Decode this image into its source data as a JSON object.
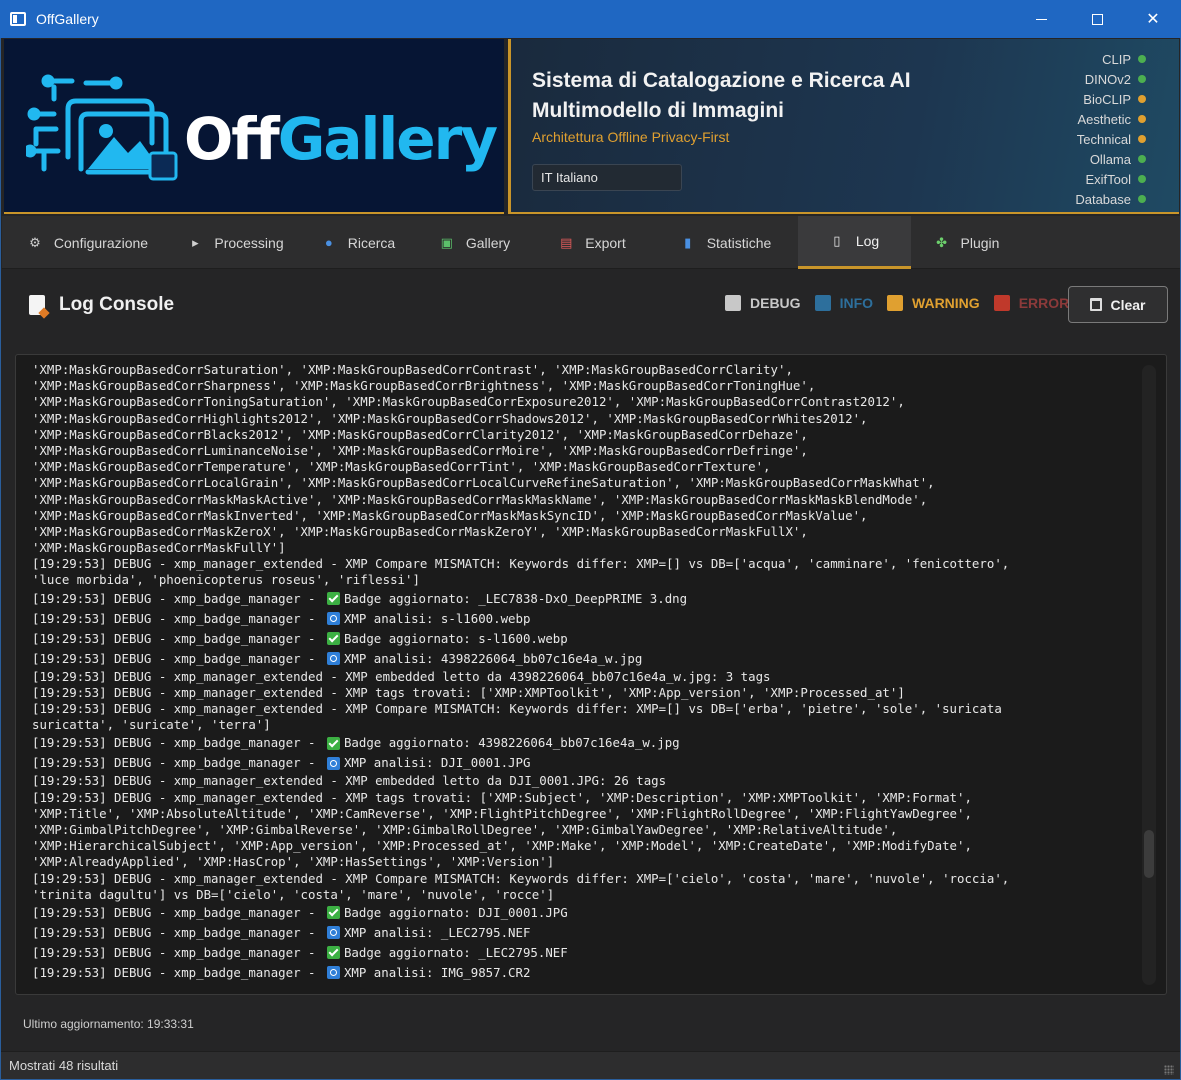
{
  "window": {
    "title": "OffGallery"
  },
  "header": {
    "logo_text_white": "Off",
    "logo_text_blue": "Gallery",
    "title": "Sistema di Catalogazione e Ricerca AI Multimodello di Immagini",
    "subtitle": "Architettura Offline Privacy-First",
    "language_select": "IT Italiano",
    "status": [
      {
        "name": "CLIP",
        "color": "#4caf50"
      },
      {
        "name": "DINOv2",
        "color": "#4caf50"
      },
      {
        "name": "BioCLIP",
        "color": "#e0a030"
      },
      {
        "name": "Aesthetic",
        "color": "#e0a030"
      },
      {
        "name": "Technical",
        "color": "#e0a030"
      },
      {
        "name": "Ollama",
        "color": "#4caf50"
      },
      {
        "name": "ExifTool",
        "color": "#4caf50"
      },
      {
        "name": "Database",
        "color": "#4caf50"
      }
    ]
  },
  "tabs": [
    {
      "label": "Configurazione",
      "icon": "gear-icon",
      "active": false
    },
    {
      "label": "Processing",
      "icon": "play-icon",
      "active": false
    },
    {
      "label": "Ricerca",
      "icon": "search-icon",
      "active": false
    },
    {
      "label": "Gallery",
      "icon": "image-icon",
      "active": false
    },
    {
      "label": "Export",
      "icon": "export-icon",
      "active": false
    },
    {
      "label": "Statistiche",
      "icon": "chart-icon",
      "active": false
    },
    {
      "label": "Log",
      "icon": "document-icon",
      "active": true
    },
    {
      "label": "Plugin",
      "icon": "puzzle-icon",
      "active": false
    }
  ],
  "console": {
    "title": "Log Console",
    "filters": [
      {
        "label": "DEBUG",
        "color": "#c8c8c8",
        "text_color": "#c8c8c8"
      },
      {
        "label": "INFO",
        "color": "#2d6f9c",
        "text_color": "#2d6f9c"
      },
      {
        "label": "WARNING",
        "color": "#e0a030",
        "text_color": "#e0a030"
      },
      {
        "label": "ERROR",
        "color": "#c0392b",
        "text_color": "#8c3a3a"
      }
    ],
    "clear_label": "Clear",
    "lines": [
      {
        "text": "'XMP:MaskGroupBasedCorrSaturation', 'XMP:MaskGroupBasedCorrContrast', 'XMP:MaskGroupBasedCorrClarity',",
        "badge": ""
      },
      {
        "text": "'XMP:MaskGroupBasedCorrSharpness', 'XMP:MaskGroupBasedCorrBrightness', 'XMP:MaskGroupBasedCorrToningHue',",
        "badge": ""
      },
      {
        "text": "'XMP:MaskGroupBasedCorrToningSaturation', 'XMP:MaskGroupBasedCorrExposure2012', 'XMP:MaskGroupBasedCorrContrast2012',",
        "badge": ""
      },
      {
        "text": "'XMP:MaskGroupBasedCorrHighlights2012', 'XMP:MaskGroupBasedCorrShadows2012', 'XMP:MaskGroupBasedCorrWhites2012',",
        "badge": ""
      },
      {
        "text": "'XMP:MaskGroupBasedCorrBlacks2012', 'XMP:MaskGroupBasedCorrClarity2012', 'XMP:MaskGroupBasedCorrDehaze',",
        "badge": ""
      },
      {
        "text": "'XMP:MaskGroupBasedCorrLuminanceNoise', 'XMP:MaskGroupBasedCorrMoire', 'XMP:MaskGroupBasedCorrDefringe',",
        "badge": ""
      },
      {
        "text": "'XMP:MaskGroupBasedCorrTemperature', 'XMP:MaskGroupBasedCorrTint', 'XMP:MaskGroupBasedCorrTexture',",
        "badge": ""
      },
      {
        "text": "'XMP:MaskGroupBasedCorrLocalGrain', 'XMP:MaskGroupBasedCorrLocalCurveRefineSaturation', 'XMP:MaskGroupBasedCorrMaskWhat',",
        "badge": ""
      },
      {
        "text": "'XMP:MaskGroupBasedCorrMaskMaskActive', 'XMP:MaskGroupBasedCorrMaskMaskName', 'XMP:MaskGroupBasedCorrMaskMaskBlendMode',",
        "badge": ""
      },
      {
        "text": "'XMP:MaskGroupBasedCorrMaskInverted', 'XMP:MaskGroupBasedCorrMaskMaskSyncID', 'XMP:MaskGroupBasedCorrMaskValue',",
        "badge": ""
      },
      {
        "text": "'XMP:MaskGroupBasedCorrMaskZeroX', 'XMP:MaskGroupBasedCorrMaskZeroY', 'XMP:MaskGroupBasedCorrMaskFullX',",
        "badge": ""
      },
      {
        "text": "'XMP:MaskGroupBasedCorrMaskFullY']",
        "badge": ""
      },
      {
        "text": "[19:29:53] DEBUG - xmp_manager_extended - XMP Compare MISMATCH: Keywords differ: XMP=[] vs DB=['acqua', 'camminare', 'fenicottero',",
        "badge": ""
      },
      {
        "text": "'luce morbida', 'phoenicopterus roseus', 'riflessi']",
        "badge": ""
      },
      {
        "prefix": "[19:29:53] DEBUG - xmp_badge_manager - ",
        "text": "Badge aggiornato: _LEC7838-DxO_DeepPRIME 3.dng",
        "badge": "ok"
      },
      {
        "prefix": "[19:29:53] DEBUG - xmp_badge_manager - ",
        "text": "XMP analisi: s-l1600.webp",
        "badge": "sync"
      },
      {
        "prefix": "[19:29:53] DEBUG - xmp_badge_manager - ",
        "text": "Badge aggiornato: s-l1600.webp",
        "badge": "ok"
      },
      {
        "prefix": "[19:29:53] DEBUG - xmp_badge_manager - ",
        "text": "XMP analisi: 4398226064_bb07c16e4a_w.jpg",
        "badge": "sync"
      },
      {
        "text": "[19:29:53] DEBUG - xmp_manager_extended - XMP embedded letto da 4398226064_bb07c16e4a_w.jpg: 3 tags",
        "badge": ""
      },
      {
        "text": "[19:29:53] DEBUG - xmp_manager_extended - XMP tags trovati: ['XMP:XMPToolkit', 'XMP:App_version', 'XMP:Processed_at']",
        "badge": ""
      },
      {
        "text": "[19:29:53] DEBUG - xmp_manager_extended - XMP Compare MISMATCH: Keywords differ: XMP=[] vs DB=['erba', 'pietre', 'sole', 'suricata",
        "badge": ""
      },
      {
        "text": "suricatta', 'suricate', 'terra']",
        "badge": ""
      },
      {
        "prefix": "[19:29:53] DEBUG - xmp_badge_manager - ",
        "text": "Badge aggiornato: 4398226064_bb07c16e4a_w.jpg",
        "badge": "ok"
      },
      {
        "prefix": "[19:29:53] DEBUG - xmp_badge_manager - ",
        "text": "XMP analisi: DJI_0001.JPG",
        "badge": "sync"
      },
      {
        "text": "[19:29:53] DEBUG - xmp_manager_extended - XMP embedded letto da DJI_0001.JPG: 26 tags",
        "badge": ""
      },
      {
        "text": "[19:29:53] DEBUG - xmp_manager_extended - XMP tags trovati: ['XMP:Subject', 'XMP:Description', 'XMP:XMPToolkit', 'XMP:Format',",
        "badge": ""
      },
      {
        "text": "'XMP:Title', 'XMP:AbsoluteAltitude', 'XMP:CamReverse', 'XMP:FlightPitchDegree', 'XMP:FlightRollDegree', 'XMP:FlightYawDegree',",
        "badge": ""
      },
      {
        "text": "'XMP:GimbalPitchDegree', 'XMP:GimbalReverse', 'XMP:GimbalRollDegree', 'XMP:GimbalYawDegree', 'XMP:RelativeAltitude',",
        "badge": ""
      },
      {
        "text": "'XMP:HierarchicalSubject', 'XMP:App_version', 'XMP:Processed_at', 'XMP:Make', 'XMP:Model', 'XMP:CreateDate', 'XMP:ModifyDate',",
        "badge": ""
      },
      {
        "text": "'XMP:AlreadyApplied', 'XMP:HasCrop', 'XMP:HasSettings', 'XMP:Version']",
        "badge": ""
      },
      {
        "text": "[19:29:53] DEBUG - xmp_manager_extended - XMP Compare MISMATCH: Keywords differ: XMP=['cielo', 'costa', 'mare', 'nuvole', 'roccia',",
        "badge": ""
      },
      {
        "text": "'trinita dagultu'] vs DB=['cielo', 'costa', 'mare', 'nuvole', 'rocce']",
        "badge": ""
      },
      {
        "prefix": "[19:29:53] DEBUG - xmp_badge_manager - ",
        "text": "Badge aggiornato: DJI_0001.JPG",
        "badge": "ok"
      },
      {
        "prefix": "[19:29:53] DEBUG - xmp_badge_manager - ",
        "text": "XMP analisi: _LEC2795.NEF",
        "badge": "sync"
      },
      {
        "prefix": "[19:29:53] DEBUG - xmp_badge_manager - ",
        "text": "Badge aggiornato: _LEC2795.NEF",
        "badge": "ok"
      },
      {
        "prefix": "[19:29:53] DEBUG - xmp_badge_manager - ",
        "text": "XMP analisi: IMG_9857.CR2",
        "badge": "sync"
      }
    ],
    "updated": "Ultimo aggiornamento: 19:33:31"
  },
  "statusbar": {
    "text": "Mostrati 48 risultati"
  }
}
